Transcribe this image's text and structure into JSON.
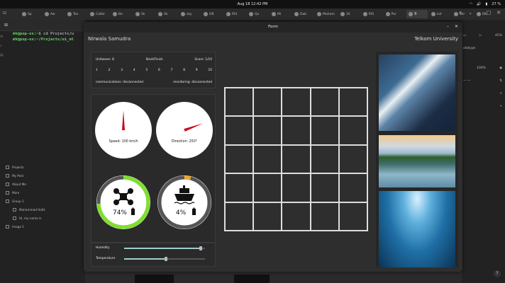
{
  "system": {
    "clock": "Aug 18  12:42 PM",
    "battery": "27 %"
  },
  "browser": {
    "tabs": [
      "Sp",
      "Aw",
      "Tex",
      "Calibr",
      "Be",
      "Sk",
      "Sk",
      "sky",
      "OR",
      "RIS",
      "Qu",
      "Mi",
      "Dab",
      "Muham",
      "10",
      "RIS",
      "Por",
      "Tr",
      "Let",
      "Ser",
      "OK"
    ],
    "active_tab_index": 17
  },
  "terminal": {
    "line1_user": "mh@pop-os:~$",
    "line1_cmd": " cd Projects/u",
    "line2_prompt": "mh@pop-os:~/Projects/ui_ml"
  },
  "editor": {
    "layers": [
      {
        "label": "Projects",
        "sub": false
      },
      {
        "label": "My Post",
        "sub": false
      },
      {
        "label": "About Me",
        "sub": false
      },
      {
        "label": "More",
        "sub": false
      },
      {
        "label": "Group 1",
        "sub": false
      },
      {
        "label": "Muhammad Hafiz",
        "sub": true
      },
      {
        "label": "Hi, my name is",
        "sub": true
      },
      {
        "label": "image 1",
        "sub": false
      }
    ],
    "right": {
      "zoom": "45%",
      "label": "ototype",
      "fill": "100%"
    }
  },
  "window": {
    "title": "Form",
    "left_header": "Nirwala Samudra",
    "right_header": "Telkom University"
  },
  "info": {
    "unfaasen": "Unfaasen: 8",
    "start_finish": "Start/Finish",
    "score": "Score: 1/10",
    "checkpoints": [
      "1",
      "2",
      "3",
      "4",
      "5",
      "6",
      "7",
      "8",
      "9",
      "10"
    ],
    "communications": "communications: disconnected",
    "monitoring": "monitoring: disconnected"
  },
  "gauges": {
    "speed_label": "Speed: 100 km/h",
    "speed_value": 100,
    "direction_label": "Direction: 250°",
    "direction_value": 250,
    "drone_battery": "74%",
    "drone_battery_value": 74,
    "ship_battery": "4%",
    "ship_battery_value": 4,
    "colors": {
      "needle": "#d0021b",
      "drone_ring": "#7ee02a",
      "ship_ring": "#f5a623"
    }
  },
  "sliders": {
    "humidity_label": "Humidity",
    "humidity_value": 0.95,
    "temperature_label": "Temperature",
    "temperature_value": 0.52
  },
  "grid": {
    "rows": 5,
    "cols": 5
  }
}
